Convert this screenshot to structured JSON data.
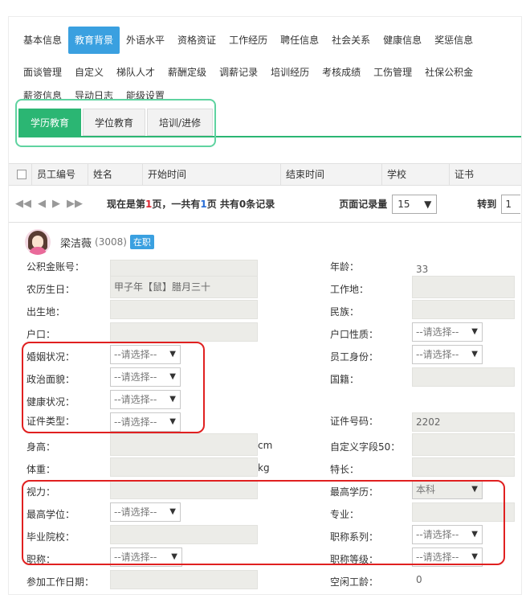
{
  "nav": {
    "row1": [
      "基本信息",
      "教育背景",
      "外语水平",
      "资格资证",
      "工作经历",
      "聘任信息",
      "社会关系",
      "健康信息",
      "奖惩信息"
    ],
    "row2": [
      "面谈管理",
      "自定义",
      "梯队人才",
      "薪酬定级",
      "调薪记录",
      "培训经历",
      "考核成绩",
      "工伤管理",
      "社保公积金"
    ],
    "row3": [
      "薪资信息",
      "导动日志",
      "能级设置"
    ],
    "active": "教育背景"
  },
  "subtabs": {
    "items": [
      "学历教育",
      "学位教育",
      "培训/进修"
    ],
    "active": "学历教育"
  },
  "grid": {
    "columns": [
      "员工编号",
      "姓名",
      "开始时间",
      "结束时间",
      "学校",
      "证书"
    ]
  },
  "pager": {
    "status_prefix": "现在是第",
    "current_page": "1",
    "status_mid": "页，一共有",
    "total_pages": "1",
    "status_suffix": "页 共有0条记录",
    "size_label": "页面记录量",
    "page_size": "15",
    "goto_label": "转到",
    "goto_value": "1"
  },
  "profile": {
    "name": "梁洁薇",
    "id": "(3008)",
    "status": "在职"
  },
  "form": {
    "left": [
      {
        "label": "公积金账号：",
        "value": ""
      },
      {
        "label": "农历生日：",
        "value": "甲子年【鼠】腊月三十"
      },
      {
        "label": "出生地：",
        "value": ""
      },
      {
        "label": "户口：",
        "value": ""
      },
      {
        "label": "婚姻状况：",
        "value": "--请选择--"
      },
      {
        "label": "政治面貌：",
        "value": "--请选择--"
      },
      {
        "label": "健康状况：",
        "value": "--请选择--"
      },
      {
        "label": "证件类型：",
        "value": "--请选择--"
      },
      {
        "label": "身高：",
        "value": "",
        "unit": "cm"
      },
      {
        "label": "体重：",
        "value": "",
        "unit": "kg"
      },
      {
        "label": "视力：",
        "value": ""
      },
      {
        "label": "最高学位：",
        "value": "--请选择--"
      },
      {
        "label": "毕业院校：",
        "value": ""
      },
      {
        "label": "职称：",
        "value": "--请选择--"
      },
      {
        "label": "参加工作日期：",
        "value": ""
      }
    ],
    "right": [
      {
        "label": "年龄：",
        "value": "33"
      },
      {
        "label": "工作地：",
        "value": ""
      },
      {
        "label": "民族：",
        "value": ""
      },
      {
        "label": "户口性质：",
        "value": "--请选择--"
      },
      {
        "label": "员工身份：",
        "value": "--请选择--"
      },
      {
        "label": "国籍：",
        "value": ""
      },
      {
        "label": "证件号码：",
        "value": "2202"
      },
      {
        "label": "自定义字段50：",
        "value": ""
      },
      {
        "label": "特长：",
        "value": ""
      },
      {
        "label": "最高学历：",
        "value": "本科"
      },
      {
        "label": "专业：",
        "value": ""
      },
      {
        "label": "职称系列：",
        "value": "--请选择--"
      },
      {
        "label": "职称等级：",
        "value": "--请选择--"
      },
      {
        "label": "空闲工龄：",
        "value": "0"
      }
    ]
  },
  "colors": {
    "active_nav": "#3aa0e0",
    "active_subtab": "#2bb673",
    "highlight_green": "#5fd3a0",
    "highlight_red": "#e02020",
    "status_number": "#d9232e"
  }
}
